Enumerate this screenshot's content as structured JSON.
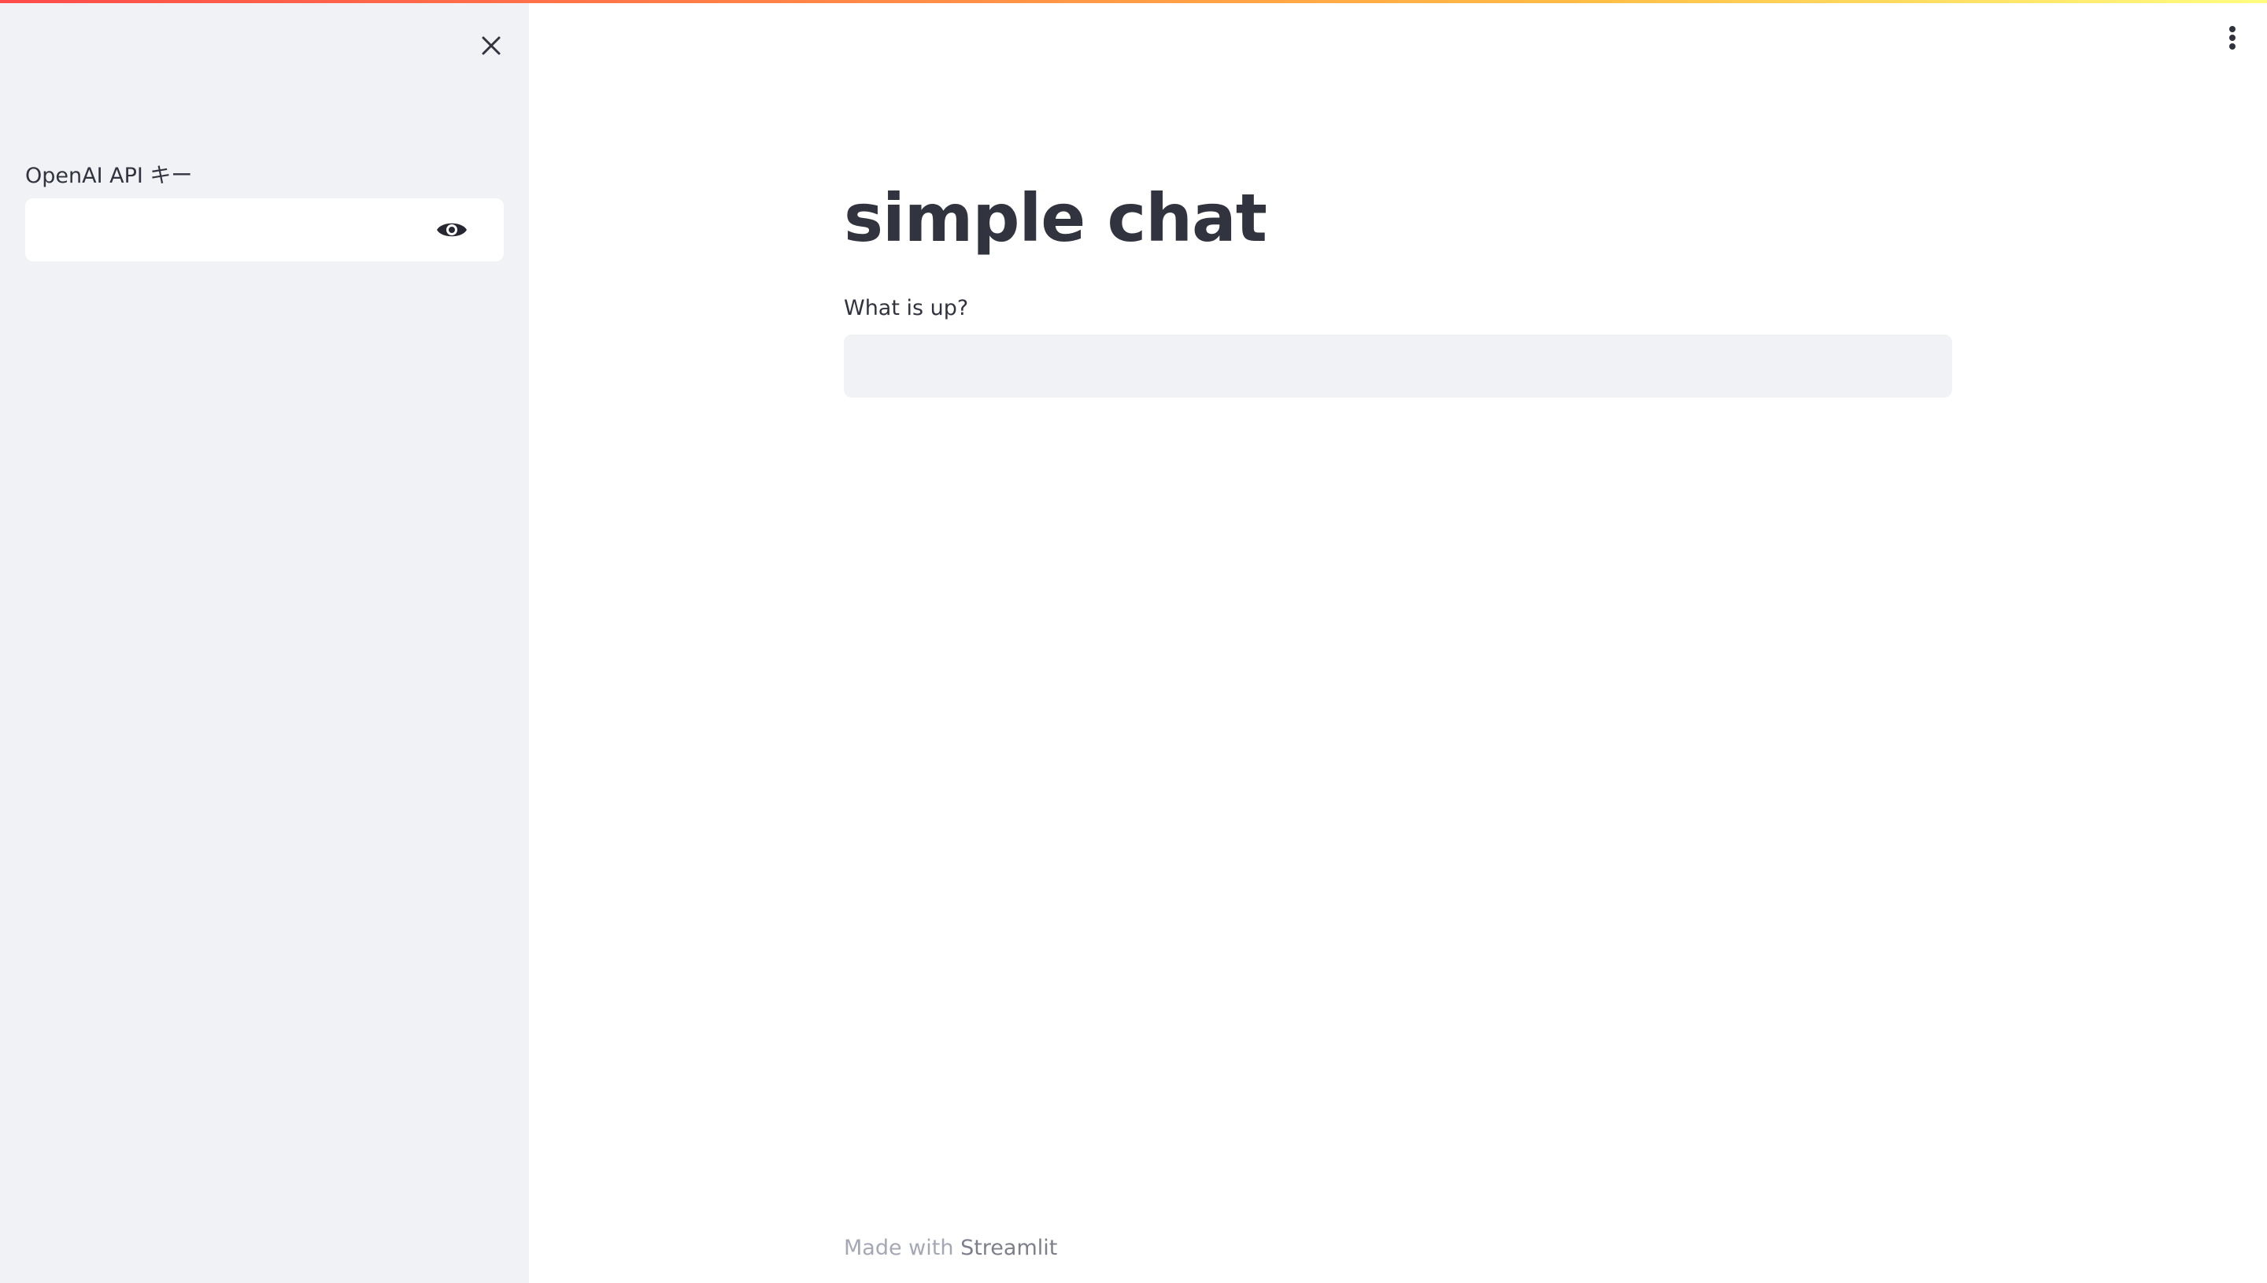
{
  "sidebar": {
    "close_icon": "close-icon",
    "api_key_label": "OpenAI API キー",
    "api_key_value": "",
    "api_key_toggle_icon": "eye-icon"
  },
  "header": {
    "menu_icon": "vertical-dots-icon"
  },
  "main": {
    "title": "simple chat",
    "chat_label": "What is up?",
    "chat_value": ""
  },
  "footer": {
    "made_with": "Made with",
    "link_text": "Streamlit"
  },
  "colors": {
    "sidebar_bg": "#f0f2f6",
    "text": "#31333f",
    "gradient_start": "#ff4b4b",
    "gradient_end": "#fffd80"
  }
}
